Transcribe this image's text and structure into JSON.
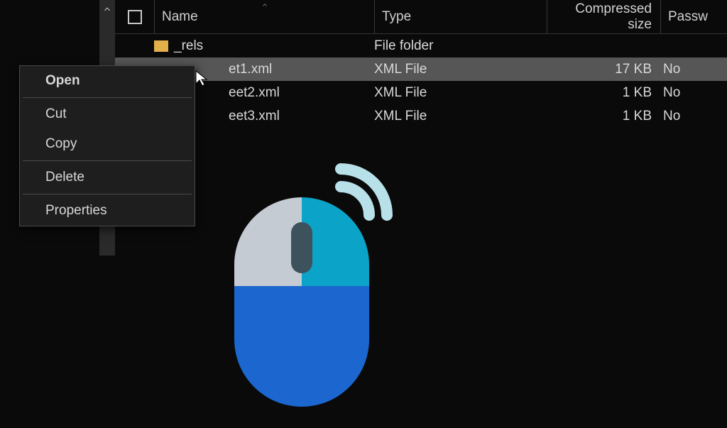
{
  "columns": {
    "name": "Name",
    "type": "Type",
    "compressed_size": "Compressed size",
    "password": "Passw"
  },
  "rows": [
    {
      "name": "_rels",
      "type": "File folder",
      "size": "",
      "password": "",
      "icon": "folder",
      "selected": false
    },
    {
      "name": "et1.xml",
      "type": "XML File",
      "size": "17 KB",
      "password": "No",
      "icon": "xml",
      "selected": true
    },
    {
      "name": "eet2.xml",
      "type": "XML File",
      "size": "1 KB",
      "password": "No",
      "icon": "xml",
      "selected": false
    },
    {
      "name": "eet3.xml",
      "type": "XML File",
      "size": "1 KB",
      "password": "No",
      "icon": "xml",
      "selected": false
    }
  ],
  "context_menu": {
    "open": "Open",
    "cut": "Cut",
    "copy": "Copy",
    "delete": "Delete",
    "properties": "Properties"
  }
}
